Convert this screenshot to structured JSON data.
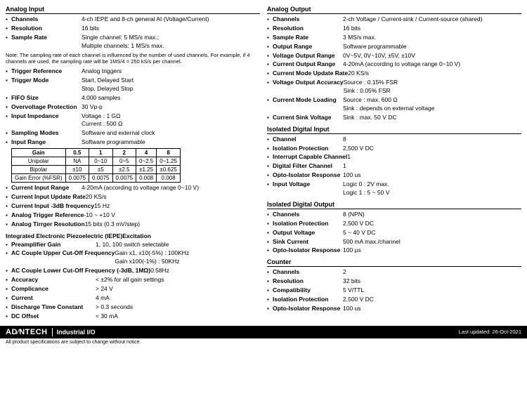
{
  "left": {
    "analog_input_title": "Analog Input",
    "channels_label": "Channels",
    "channels_value": "4-ch IEPE and 8-ch general AI (Voltage/Current)",
    "resolution_label": "Resolution",
    "resolution_value": "16 bits",
    "sample_rate_label": "Sample Rate",
    "sample_rate_value_1": "Single channel: 5 MS/s max.;",
    "sample_rate_value_2": "Multiple channels: 1 MS/s max.",
    "note": "Note: The sampling rate of each channel is influenced by the number of used channels. For example, if 4 channels are used, the sampling rate will be 1MS/4 = 250 kS/s per channel.",
    "trigger_reference_label": "Trigger Reference",
    "trigger_reference_value": "Analog triggers",
    "trigger_mode_label": "Trigger Mode",
    "trigger_mode_value_1": "Start, Delayed Start",
    "trigger_mode_value_2": "Stop, Delayed Stop",
    "fifo_label": "FIFO Size",
    "fifo_value": "4,000 samples",
    "overvoltage_label": "Overvoltage Protection",
    "overvoltage_value": "30 Vp-p",
    "input_impedance_label": "Input Impedance",
    "input_impedance_value_1": "Voltage : 1 GΩ",
    "input_impedance_value_2": "Current : 500 Ω",
    "sampling_modes_label": "Sampling Modes",
    "sampling_modes_value": "Software and external clock",
    "input_range_label": "Input Range",
    "input_range_value": "Software programmable",
    "gain_table": {
      "headers": [
        "Gain",
        "0.5",
        "1",
        "2",
        "4",
        "8"
      ],
      "rows": [
        [
          "Unipolar",
          "NA",
          "0~10",
          "0~5",
          "0~2.5",
          "0~1.25"
        ],
        [
          "Bipolar",
          "±10",
          "±5",
          "±2.5",
          "±1.25",
          "±0.625"
        ],
        [
          "Gain Error (%FSR)",
          "0.0075",
          "0.0075",
          "0.0075",
          "0.008",
          "0.008"
        ]
      ]
    },
    "current_input_range_label": "Current Input Range",
    "current_input_range_value": "4-20mA (according to voltage range 0~10 V)",
    "current_input_update_label": "Current Input Update Rate",
    "current_input_update_value": "20 KS/s",
    "current_input_3db_label": "Current Input -3dB frequency",
    "current_input_3db_value": "15 Hz",
    "analog_trigger_label": "Analog Trigger Reference",
    "analog_trigger_value": "-10 ~ +10 V",
    "analog_trigger_res_label": "Analog Tirrger Resolution",
    "analog_trigger_res_value": "15 bits (0.3 mV/step)",
    "iepe_title": "Integrated Electronic Piezoelectric (IEPE)Excitation",
    "preamplifier_label": "Preamplifier Gain",
    "preamplifier_value": "1, 10, 100 switch selectable",
    "ac_couple_upper_label": "AC Couple Upper Cut-Off Frequency",
    "ac_couple_upper_value_1": "Gain x1, x10(-5%) : 100KHz",
    "ac_couple_upper_value_2": "Gain x100(-1%) : 50KHz",
    "ac_couple_lower_label": "AC Couple Lower Cut-Off Frequency (-3dB, 1MΩ)",
    "ac_couple_lower_value": "0.58Hz",
    "accuracy_label": "Accuracy",
    "accuracy_value": "< ±2% for all gain settings",
    "complicance_label": "Complicance",
    "complicance_value": "> 24 V",
    "current_label": "Current",
    "current_value": "4 mA",
    "discharge_label": "Discharge Time Constant",
    "discharge_value": "> 0.3 seconds",
    "dc_offset_label": "DC Offset",
    "dc_offset_value": "< 30 mA"
  },
  "right": {
    "analog_output_title": "Analog Output",
    "channels_label": "Channels",
    "channels_value": "2-ch Voltage / Current-sink / Current-source (shared)",
    "resolution_label": "Resolution",
    "resolution_value": "16 bits",
    "sample_rate_label": "Sample Rate",
    "sample_rate_value": "3 MS/s max.",
    "output_range_label": "Output Range",
    "output_range_value": "Software programmable",
    "voltage_output_label": "Voltage Output Range",
    "voltage_output_value": "0V~5V, 0V~10V, ±5V, ±10V",
    "current_output_label": "Current Output Range",
    "current_output_value": "4-20mA (according to voltage range 0~10 V)",
    "current_mode_update_label": "Current Mode Update Rate",
    "current_mode_update_value": "20 KS/s",
    "voltage_output_accuracy_label": "Voltage Output Accuracy",
    "voltage_output_accuracy_value_1": "Source : 0.15% FSR",
    "voltage_output_accuracy_value_2": "Sink : 0.05% FSR",
    "current_mode_loading_label": "Current Mode Loading",
    "current_mode_loading_value_1": "Source : max. 600 Ω",
    "current_mode_loading_value_2": "Sink : depends on external voltage",
    "current_sink_label": "Current Sink Voltage",
    "current_sink_value_1": "Sink : max. 50 V DC",
    "isolated_digital_input_title": "Isolated Digital Input",
    "channel_label": "Channel",
    "channel_value": "8",
    "isolation_protection_label": "Isolation Protection",
    "isolation_protection_value": "2,500 V DC",
    "interrupt_capable_label": "Interrupt Capable Channel",
    "interrupt_capable_value": "1",
    "digital_filter_label": "Digital Filter Channel",
    "digital_filter_value": "1",
    "opto_isolator_label": "Opto-Isolator Response",
    "opto_isolator_value": "100 us",
    "input_voltage_label": "Input Voltage",
    "input_voltage_value_1": "Logic 0 : 2V max.",
    "input_voltage_value_2": "Logic 1 : 5 ~ 50 V",
    "isolated_digital_output_title": "Isolated Digital Output",
    "out_channels_label": "Channels",
    "out_channels_value": "8 (NPN)",
    "out_isolation_label": "Isolation Protection",
    "out_isolation_value": "2,500 V DC",
    "out_voltage_label": "Output Voltage",
    "out_voltage_value": "5 ~ 40 V DC",
    "sink_current_label": "Sink Current",
    "sink_current_value": "500 mA max./channel",
    "out_opto_label": "Opto-Isolator Response",
    "out_opto_value": "100 µs",
    "counter_title": "Counter",
    "counter_channels_label": "Channels",
    "counter_channels_value": "2",
    "counter_resolution_label": "Resolution",
    "counter_resolution_value": "32 bits",
    "counter_compatibility_label": "Compatibility",
    "counter_compatibility_value": "5 V/TTL",
    "counter_isolation_label": "Isolation Protection",
    "counter_isolation_value": "2,500 V DC",
    "counter_opto_label": "Opto-Isolator Response",
    "counter_opto_value": "100 us"
  },
  "footer": {
    "brand": "AD∕NTECH",
    "subtitle": "Industrial I/O",
    "note": "All product specifications are subject to change without notice.",
    "date": "Last updated: 26-Oct-2021"
  }
}
